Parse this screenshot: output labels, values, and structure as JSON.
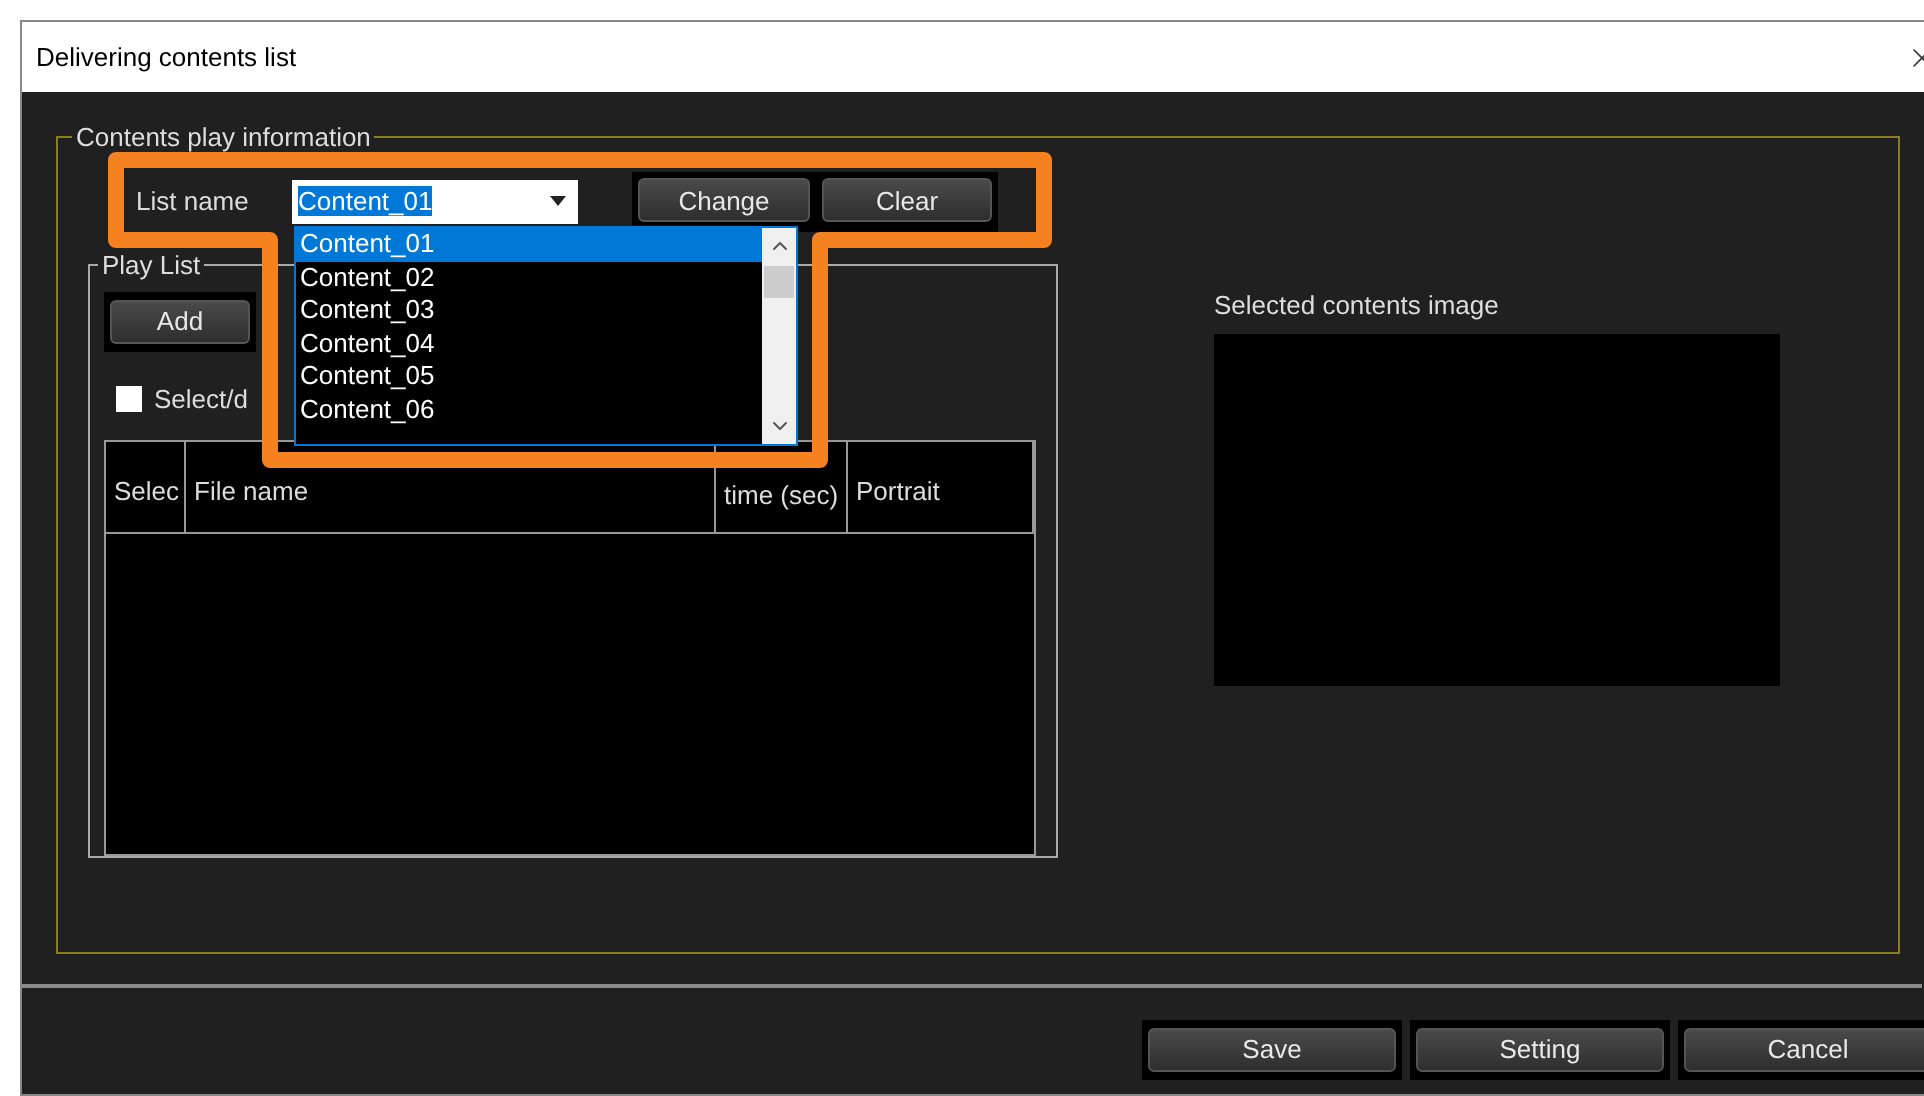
{
  "window": {
    "title": "Delivering contents list"
  },
  "contents_play_information": {
    "title": "Contents play information",
    "list_name_label": "List name",
    "list_name_value": "Content_01",
    "buttons": [
      "Change",
      "Clear"
    ],
    "dropdown": {
      "items": [
        {
          "label": "Content_01",
          "selected": true
        },
        {
          "label": "Content_02",
          "selected": false
        },
        {
          "label": "Content_03",
          "selected": false
        },
        {
          "label": "Content_04",
          "selected": false
        },
        {
          "label": "Content_05",
          "selected": false
        },
        {
          "label": "Content_06",
          "selected": false
        }
      ]
    },
    "play_list": {
      "title": "Play List",
      "add_button": "Add",
      "select_all": {
        "label": "Select/d",
        "checked": false
      },
      "table": {
        "columns": [
          "Selec",
          "File name",
          "time (sec)",
          "Portrait"
        ]
      }
    },
    "preview": {
      "label": "Selected contents image"
    }
  },
  "buttons": [
    "Save",
    "Setting",
    "Cancel"
  ]
}
